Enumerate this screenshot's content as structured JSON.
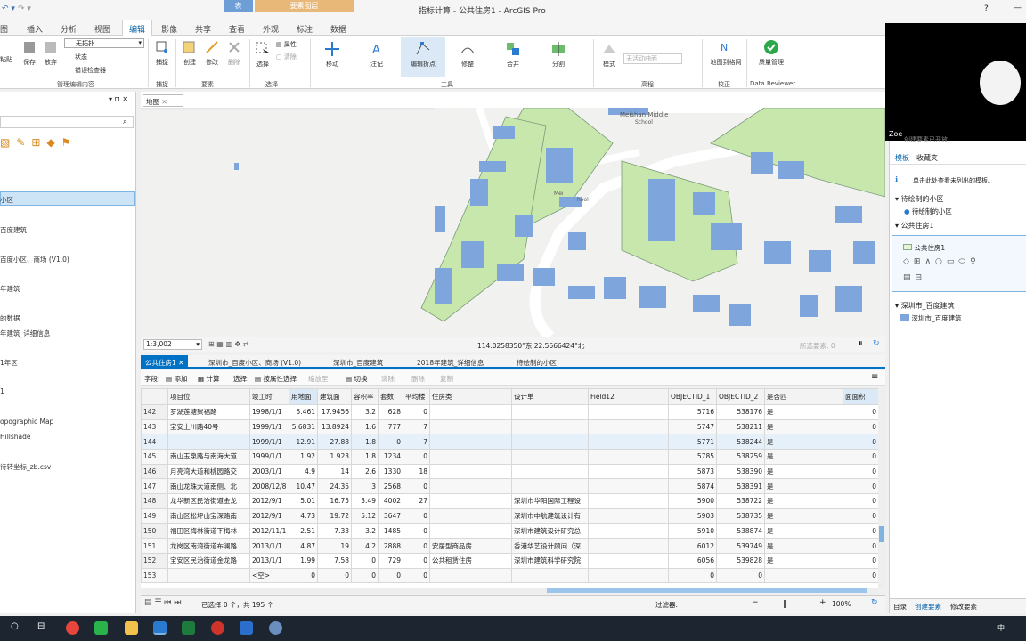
{
  "app": {
    "title": "指标计算 - 公共住房1 - ArcGIS Pro",
    "help": "?",
    "window_controls": [
      "—",
      "☐",
      "✕"
    ]
  },
  "context_tabs": {
    "table_group": "表",
    "feature_layer_group": "要素图层"
  },
  "ribbon_tabs": [
    "图",
    "插入",
    "分析",
    "视图",
    "编辑",
    "影像",
    "共享",
    "查看",
    "外观",
    "标注",
    "数据"
  ],
  "ribbon": {
    "clipboard": [
      {
        "label": "粘贴"
      },
      {
        "label": "保存"
      },
      {
        "label": "放弃"
      }
    ],
    "manage_edits": {
      "dropdown": "无拓扑",
      "status": "状态",
      "checker": "错误检查器",
      "group": "管理编辑内容"
    },
    "snapping": {
      "label": "捕捉",
      "group": "捕捉"
    },
    "features": {
      "buttons": [
        "创建",
        "修改",
        "删除"
      ],
      "group": "要素"
    },
    "selection": {
      "select": "选择",
      "attributes": "属性",
      "clear": "清除",
      "group": "选择"
    },
    "tools": {
      "buttons": [
        "移动",
        "注记",
        "编辑折点",
        "修整",
        "合并",
        "分割"
      ],
      "group": "工具"
    },
    "elevation": {
      "mode": "模式",
      "field_placeholder": "无活动曲面",
      "group": "高程"
    },
    "correction": {
      "label": "地图到格网",
      "group": "校正"
    },
    "reviewer": {
      "label": "质量管理",
      "group": "Data Reviewer"
    }
  },
  "left_pane": {
    "search_icon": "search-icon",
    "items": [
      {
        "label": "小区",
        "selected": true
      },
      {
        "label": "百度建筑"
      },
      {
        "label": "百度小区、商场 (V1.0)"
      },
      {
        "label": "年建筑"
      },
      {
        "label": "的数据"
      },
      {
        "label": "年建筑_详细信息"
      },
      {
        "label": "1年区"
      },
      {
        "label": "1"
      },
      {
        "label": "opographic Map"
      },
      {
        "label": "Hillshade"
      },
      {
        "label": "待转坐标_zb.csv"
      }
    ]
  },
  "map": {
    "tab_label": "地图",
    "labels": {
      "school_top": "Meishan Middle",
      "school_sub": "School",
      "school_mid": "Mei",
      "school_mid2": "hool"
    },
    "scale": "1:3,002",
    "coords": "114.0258350°东 22.5666424°北",
    "selected_features": "所选要素: 0"
  },
  "table_tabs": [
    "公共住房1",
    "深圳市_百度小区、商场 (V1.0)",
    "深圳市_百度建筑",
    "2018年建筑_详细信息",
    "待绘制的小区"
  ],
  "table_toolbar": {
    "field": "字段:",
    "add": "添加",
    "calculate": "计算",
    "selection": "选择:",
    "by_attr": "按属性选择",
    "zoom": "缩放至",
    "switch": "切换",
    "clear": "清除",
    "delete": "删除",
    "copy": "复制"
  },
  "table": {
    "columns": [
      "项目位",
      "竣工时",
      "用地面",
      "建筑面",
      "容积率",
      "套数",
      "平均楼",
      "住房类",
      "设计单",
      "Field12",
      "OBJECTID_1",
      "OBJECTID_2",
      "是否匹",
      "面面积"
    ],
    "rows": [
      {
        "rn": "142",
        "c": [
          "罗湖莲塘聚福路",
          "1998/1/1",
          "5.461",
          "17.9456",
          "3.2",
          "628",
          "0",
          "",
          "",
          "",
          "5716",
          "538176",
          "是",
          "0"
        ]
      },
      {
        "rn": "143",
        "c": [
          "宝安上川路40号",
          "1999/1/1",
          "5.6831",
          "13.8924",
          "1.6",
          "777",
          "7",
          "",
          "",
          "",
          "5747",
          "538211",
          "是",
          "0"
        ]
      },
      {
        "rn": "144",
        "c": [
          "",
          "1999/1/1",
          "12.91",
          "27.88",
          "1.8",
          "0",
          "7",
          "",
          "",
          "",
          "5771",
          "538244",
          "是",
          "0"
        ]
      },
      {
        "rn": "145",
        "c": [
          "南山玉泉路与南海大道",
          "1999/1/1",
          "1.92",
          "1.923",
          "1.8",
          "1234",
          "0",
          "",
          "",
          "",
          "5785",
          "538259",
          "是",
          "0"
        ]
      },
      {
        "rn": "146",
        "c": [
          "月亮湾大道和桃园路交",
          "2003/1/1",
          "4.9",
          "14",
          "2.6",
          "1330",
          "18",
          "",
          "",
          "",
          "5873",
          "538390",
          "是",
          "0"
        ]
      },
      {
        "rn": "147",
        "c": [
          "南山龙珠大道南侧、北",
          "2008/12/8",
          "10.47",
          "24.35",
          "3",
          "2568",
          "0",
          "",
          "",
          "",
          "5874",
          "538391",
          "是",
          "0"
        ]
      },
      {
        "rn": "148",
        "c": [
          "龙华新区民治街道金龙",
          "2012/9/1",
          "5.01",
          "16.75",
          "3.49",
          "4002",
          "27",
          "",
          "深圳市华阳国际工程设",
          "",
          "5900",
          "538722",
          "是",
          "0"
        ]
      },
      {
        "rn": "149",
        "c": [
          "南山区松坪山宝深路南",
          "2012/9/1",
          "4.73",
          "19.72",
          "5.12",
          "3647",
          "0",
          "",
          "深圳市中航建筑设计有",
          "",
          "5903",
          "538735",
          "是",
          "0"
        ]
      },
      {
        "rn": "150",
        "c": [
          "福田区梅林街道下梅林",
          "2012/11/1",
          "2.51",
          "7.33",
          "3.2",
          "1485",
          "0",
          "",
          "深圳市建筑设计研究总",
          "",
          "5910",
          "538874",
          "是",
          "0"
        ]
      },
      {
        "rn": "151",
        "c": [
          "龙岗区南湾街道布澜路",
          "2013/1/1",
          "4.87",
          "19",
          "4.2",
          "2888",
          "0",
          "安居型商品房",
          "香港华艺设计顾问（深",
          "",
          "6012",
          "539749",
          "是",
          "0"
        ]
      },
      {
        "rn": "152",
        "c": [
          "宝安区民治街道金龙路",
          "2013/1/1",
          "1.99",
          "7.58",
          "0",
          "729",
          "0",
          "公共租赁住房",
          "深圳市建筑科学研究院",
          "",
          "6056",
          "539828",
          "是",
          "0"
        ]
      },
      {
        "rn": "153",
        "c": [
          "",
          "<空>",
          "0",
          "0",
          "0",
          "0",
          "0",
          "",
          "",
          "",
          "0",
          "0",
          "",
          "0"
        ]
      }
    ]
  },
  "bottom_bar": {
    "status": "已选择 0 个，共 195 个",
    "filters": "过滤器:",
    "zoom": "100%"
  },
  "right_pane": {
    "top_text": "创建要素已开放",
    "tabs": [
      "模板",
      "收藏夹"
    ],
    "hint": "单击此处查看未列出的模板。",
    "groups": [
      {
        "title": "待绘制的小区",
        "items": [
          "待绘制的小区"
        ]
      },
      {
        "title": "公共住房1",
        "items": [
          "公共住房1"
        ]
      },
      {
        "title": "深圳市_百度建筑",
        "items": [
          "深圳市_百度建筑"
        ]
      }
    ],
    "bottom_tabs": [
      "目录",
      "创建要素",
      "修改要素"
    ]
  },
  "webcam": {
    "name": "Zoe"
  },
  "taskbar": {
    "time": "中",
    "apps": [
      "chrome",
      "wechat",
      "explorer",
      "arcgis",
      "excel",
      "netease",
      "photo",
      "globe"
    ]
  },
  "colors": {
    "accent": "#0072c6",
    "building": "#7ea6dc",
    "green": "#c7e7ad",
    "ribbon_active": "#dbe9f7"
  }
}
